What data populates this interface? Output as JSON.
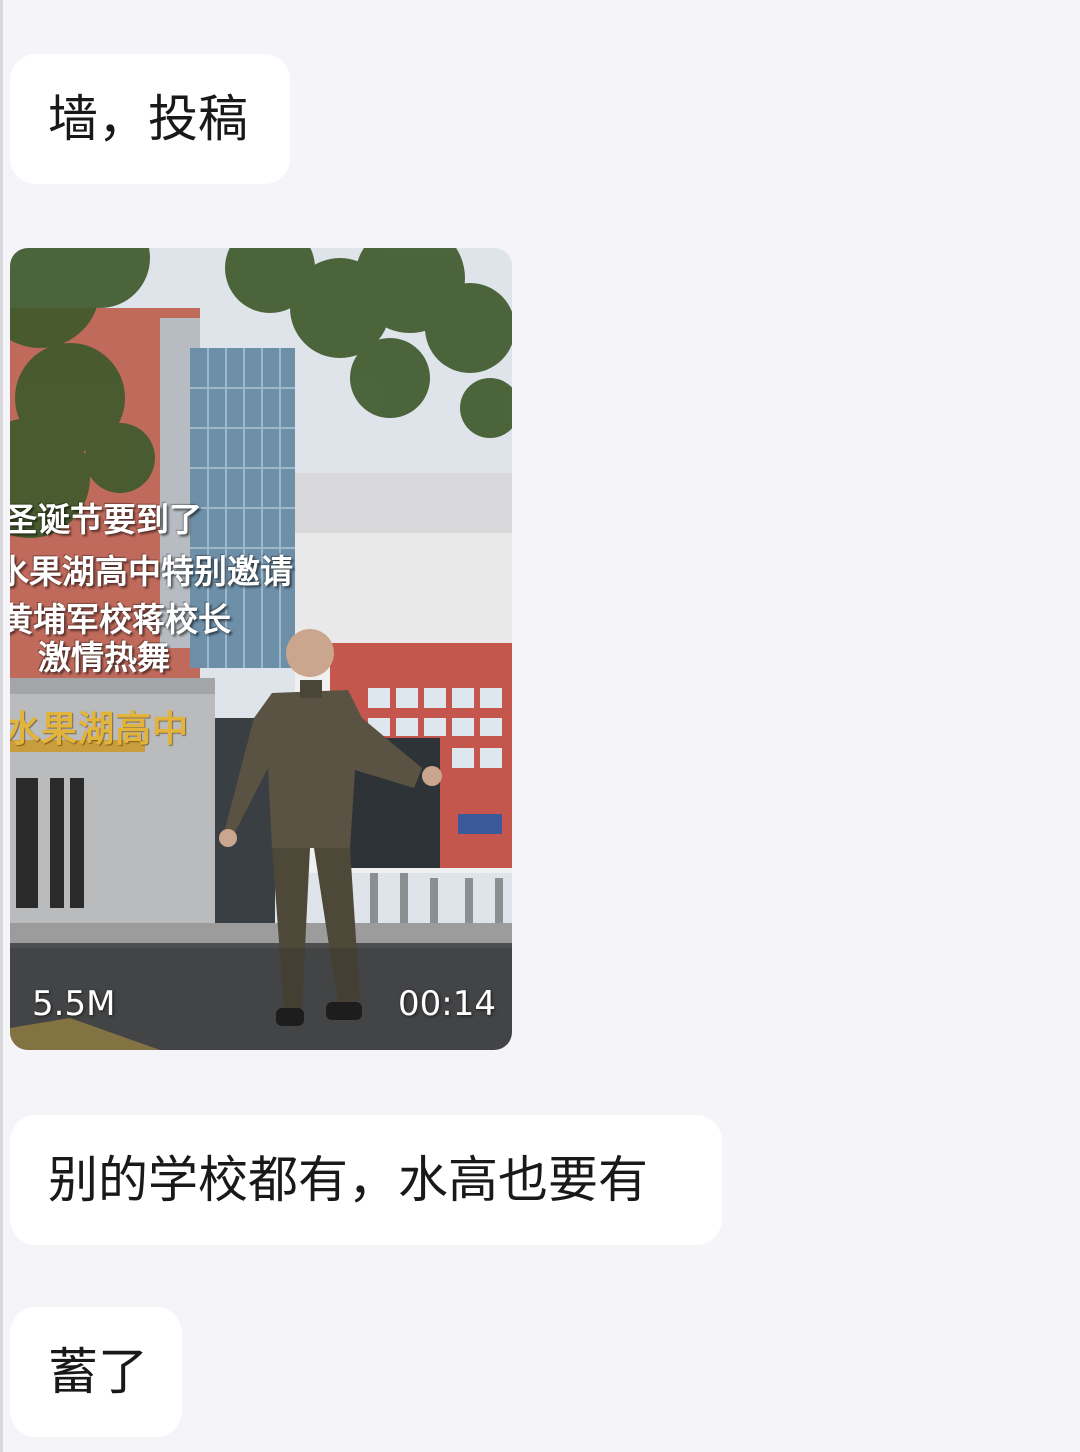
{
  "messages": [
    {
      "text": "墙，投稿"
    },
    {
      "video": {
        "captions": [
          "圣诞节要到了",
          "水果湖高中特别邀请",
          "黄埔军校蒋校长",
          "激情热舞"
        ],
        "sign_text": "水果湖高中",
        "size": "5.5M",
        "duration": "00:14"
      }
    },
    {
      "text": "别的学校都有，水高也要有"
    },
    {
      "text": "蓄了"
    }
  ],
  "colors": {
    "background": "#f5f4f9",
    "bubble": "#ffffff",
    "text": "#191919",
    "sign": "#e2b43c"
  }
}
